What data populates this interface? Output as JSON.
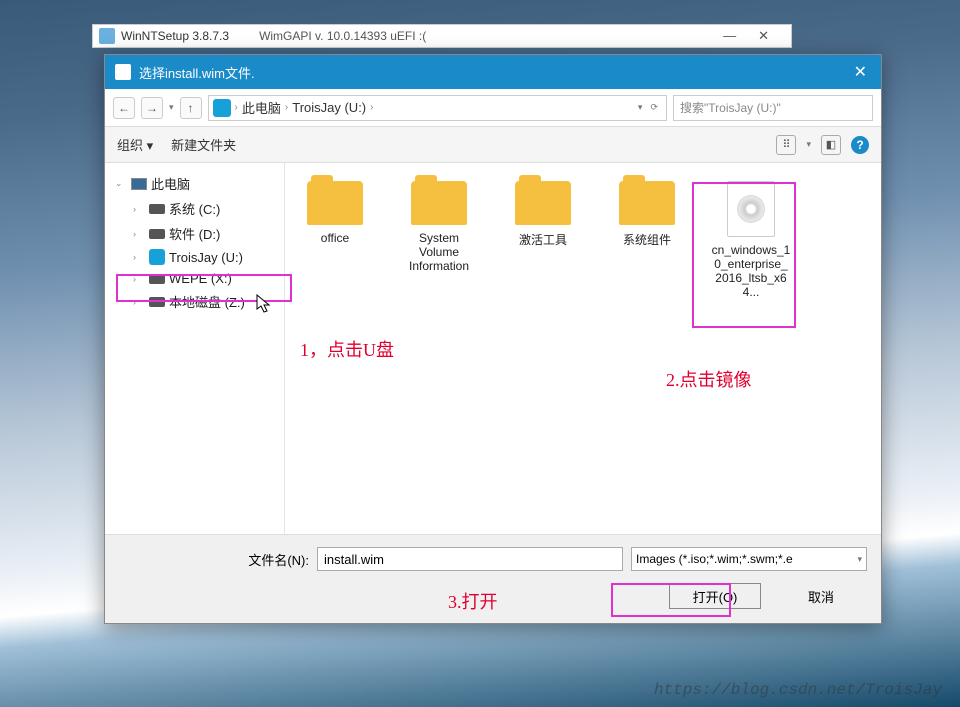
{
  "parent_window": {
    "title": "WinNTSetup 3.8.7.3",
    "subtitle": "WimGAPI v. 10.0.14393   uEFI :(",
    "minimize": "—",
    "close": "✕"
  },
  "dialog": {
    "title": "选择install.wim文件.",
    "close": "✕"
  },
  "nav": {
    "back": "←",
    "forward": "→",
    "up": "↑",
    "refresh": "⟳",
    "dropdown": "▾"
  },
  "breadcrumb": {
    "root": "此电脑",
    "current": "TroisJay (U:)",
    "sep": "›"
  },
  "search": {
    "placeholder": "搜索\"TroisJay (U:)\""
  },
  "toolbar": {
    "organize": "组织 ▾",
    "newfolder": "新建文件夹",
    "view_dd": "▾",
    "help": "?"
  },
  "tree": {
    "pc": "此电脑",
    "drives": [
      {
        "label": "系统 (C:)"
      },
      {
        "label": "软件 (D:)"
      },
      {
        "label": "TroisJay (U:)"
      },
      {
        "label": "WEPE (X:)"
      },
      {
        "label": "本地磁盘 (Z:)"
      }
    ],
    "exp_open": "⌄",
    "exp_closed": "›"
  },
  "files": [
    {
      "name": "office",
      "type": "folder"
    },
    {
      "name": "System Volume Information",
      "type": "folder"
    },
    {
      "name": "激活工具",
      "type": "folder"
    },
    {
      "name": "系统组件",
      "type": "folder"
    },
    {
      "name": "cn_windows_10_enterprise_2016_ltsb_x64...",
      "type": "iso"
    }
  ],
  "bottom": {
    "fname_label": "文件名(N):",
    "fname_value": "install.wim",
    "filter": "Images (*.iso;*.wim;*.swm;*.e",
    "open": "打开(O)",
    "cancel": "取消"
  },
  "annotations": {
    "a1": "1，点击U盘",
    "a2": "2.点击镜像",
    "a3": "3.打开"
  },
  "watermark": "https://blog.csdn.net/TroisJay"
}
